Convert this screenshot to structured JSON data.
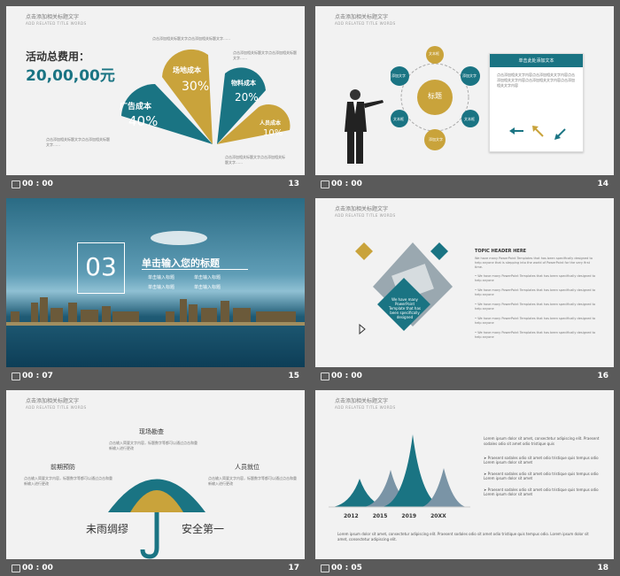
{
  "slides": [
    {
      "num": "13",
      "time": "00 : 00",
      "header": "点击添加相关标题文字",
      "header_sub": "ADD RELATED TITLE WORDS",
      "cost_label": "活动总费用：",
      "cost_value": "20,00,00元",
      "petals": [
        {
          "name": "广告成本",
          "pct": "40%",
          "color": "#1a7483"
        },
        {
          "name": "场地成本",
          "pct": "30%",
          "color": "#c9a33b"
        },
        {
          "name": "物料成本",
          "pct": "20%",
          "color": "#1a7483"
        },
        {
          "name": "人员成本",
          "pct": "10%",
          "color": "#c9a33b"
        }
      ],
      "note": "点击添加相关标题文字点击添加相关标题文字……"
    },
    {
      "num": "14",
      "time": "00 : 00",
      "header": "点击添加相关标题文字",
      "header_sub": "ADD RELATED TITLE WORDS",
      "center": "标题",
      "nodes": [
        "添加文字",
        "文本框",
        "添加文字",
        "文本框",
        "添加文字",
        "文本框"
      ],
      "panel_title": "单击此处添加文本",
      "panel_text": "点击添加相关文字内容点击添加相关文字内容点击添加相关文字内容点击添加相关文字内容点击添加相关文字内容"
    },
    {
      "num": "15",
      "time": "00 : 07",
      "number": "03",
      "title": "单击输入您的标题",
      "items": [
        "单击输入标题",
        "单击输入标题",
        "单击输入标题",
        "单击输入标题"
      ]
    },
    {
      "num": "16",
      "time": "00 : 00",
      "header": "点击添加相关标题文字",
      "header_sub": "ADD RELATED TITLE WORDS",
      "topic": "TOPIC HEADER HERE",
      "topic_text": "We have many PowerPoint Templates that has been specifically designed to help anyone that is stepping into the world of PowerPoint for the very first time.",
      "card_text": "We have many PowerPoint Template that has been specifically designed",
      "bullets": [
        "We have many PowerPoint Templates that has been specifically designed to help anyone",
        "We have many PowerPoint Templates that has been specifically designed to help anyone",
        "We have many PowerPoint Templates that has been specifically designed to help anyone",
        "We have many PowerPoint Templates that has been specifically designed to help anyone",
        "We have many PowerPoint Templates that has been specifically designed to help anyone"
      ]
    },
    {
      "num": "17",
      "time": "00 : 00",
      "header": "点击添加相关标题文字",
      "header_sub": "ADD RELATED TITLE WORDS",
      "labels": [
        "现场勘查",
        "前期预防",
        "人员就位"
      ],
      "desc": "点击输入简要文字内容，标题数字等都可以通过点击和重新输入进行更改",
      "slogan_left": "未雨绸缪",
      "slogan_right": "安全第一"
    },
    {
      "num": "18",
      "time": "00 : 05",
      "header": "点击添加相关标题文字",
      "header_sub": "ADD RELATED TITLE WORDS",
      "years": [
        "2012",
        "2015",
        "2019",
        "20XX"
      ],
      "intro": "Lorem ipsum dolor sit amet, consectetur adipiscing elit. Praesent sodales odio sit amet odio tristique quis",
      "bullets": [
        "Praesent sodales odio sit amet odio tristique quis tempus odio Lorem ipsum dolor sit amet",
        "Praesent sodales odio sit amet odio tristique quis tempus odio Lorem ipsum dolor sit amet",
        "Praesent sodales odio sit amet odio tristique quis tempus odio Lorem ipsum dolor sit amet"
      ],
      "footer": "Lorem ipsum dolor sit amet, consectetur adipiscing elit. Praesent sodales odio sit amet odio tristique quis tempus odio. Lorem ipsum dolor sit amet, consectetur adipiscing elit."
    }
  ]
}
